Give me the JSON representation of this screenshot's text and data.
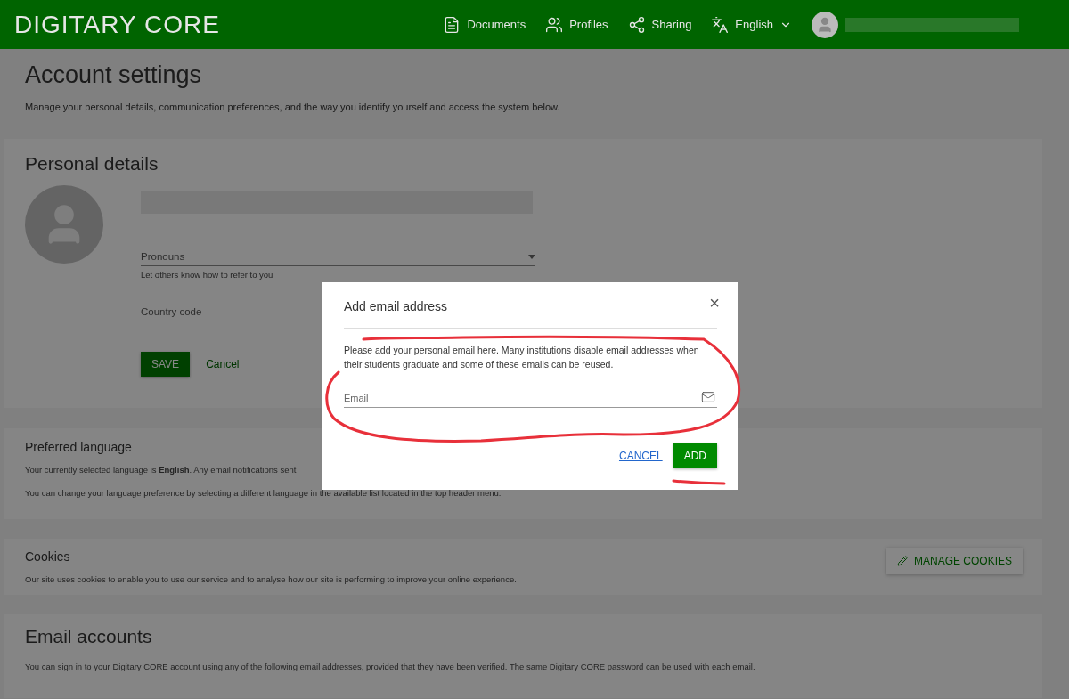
{
  "header": {
    "logo": "DIGITARY CORE",
    "nav": [
      {
        "kind": "documents",
        "label": "Documents"
      },
      {
        "kind": "profiles",
        "label": "Profiles"
      },
      {
        "kind": "sharing",
        "label": "Sharing"
      },
      {
        "kind": "language",
        "label": "English"
      }
    ]
  },
  "page": {
    "title": "Account settings",
    "subtitle": "Manage your personal details, communication preferences, and the way you identify yourself and access the system below."
  },
  "personal_details": {
    "title": "Personal details",
    "pronouns": {
      "placeholder": "Pronouns",
      "hint": "Let others know how to refer to you"
    },
    "country_code": {
      "placeholder": "Country code"
    },
    "save": "SAVE",
    "cancel": "Cancel"
  },
  "preferred_language": {
    "title": "Preferred language",
    "text": "Your currently selected language is **English**. Any email notifications sent",
    "text_2": "You can change your language preference by selecting a different language in the available list located in the top header menu."
  },
  "cookies": {
    "title": "Cookies",
    "text": "Our site uses cookies to enable you to use our service and to analyse how our site is performing to improve your online experience.",
    "button": "MANAGE COOKIES"
  },
  "email_accounts": {
    "title": "Email accounts",
    "text": "You can sign in to your Digitary CORE account using any of the following email addresses, provided that they have been verified. The same Digitary CORE password can be used with each email."
  },
  "dialog": {
    "title": "Add email address",
    "close": "×",
    "text": "Please add your personal email here. Many institutions disable email addresses when their students graduate and some of these emails can be reused.",
    "email": {
      "placeholder": "Email"
    },
    "cancel": "CANCEL",
    "add": "ADD"
  }
}
